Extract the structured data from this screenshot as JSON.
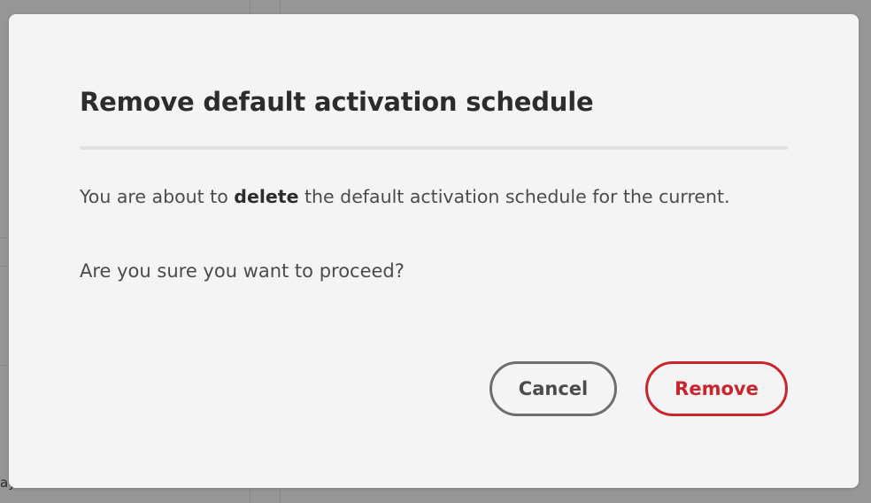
{
  "background": {
    "partial_text": "ays"
  },
  "dialog": {
    "title": "Remove default activation schedule",
    "message": {
      "prefix": "You are about to ",
      "emphasis": "delete",
      "suffix": " the default activation schedule for the current."
    },
    "question": "Are you sure you want to proceed?",
    "buttons": {
      "cancel_label": "Cancel",
      "remove_label": "Remove"
    }
  },
  "colors": {
    "overlay": "#969696",
    "dialog_background": "#f4f4f4",
    "destructive": "#c9252d",
    "secondary_border": "#6e6e6e",
    "title_text": "#2c2c2c",
    "body_text": "#4b4b4b"
  }
}
